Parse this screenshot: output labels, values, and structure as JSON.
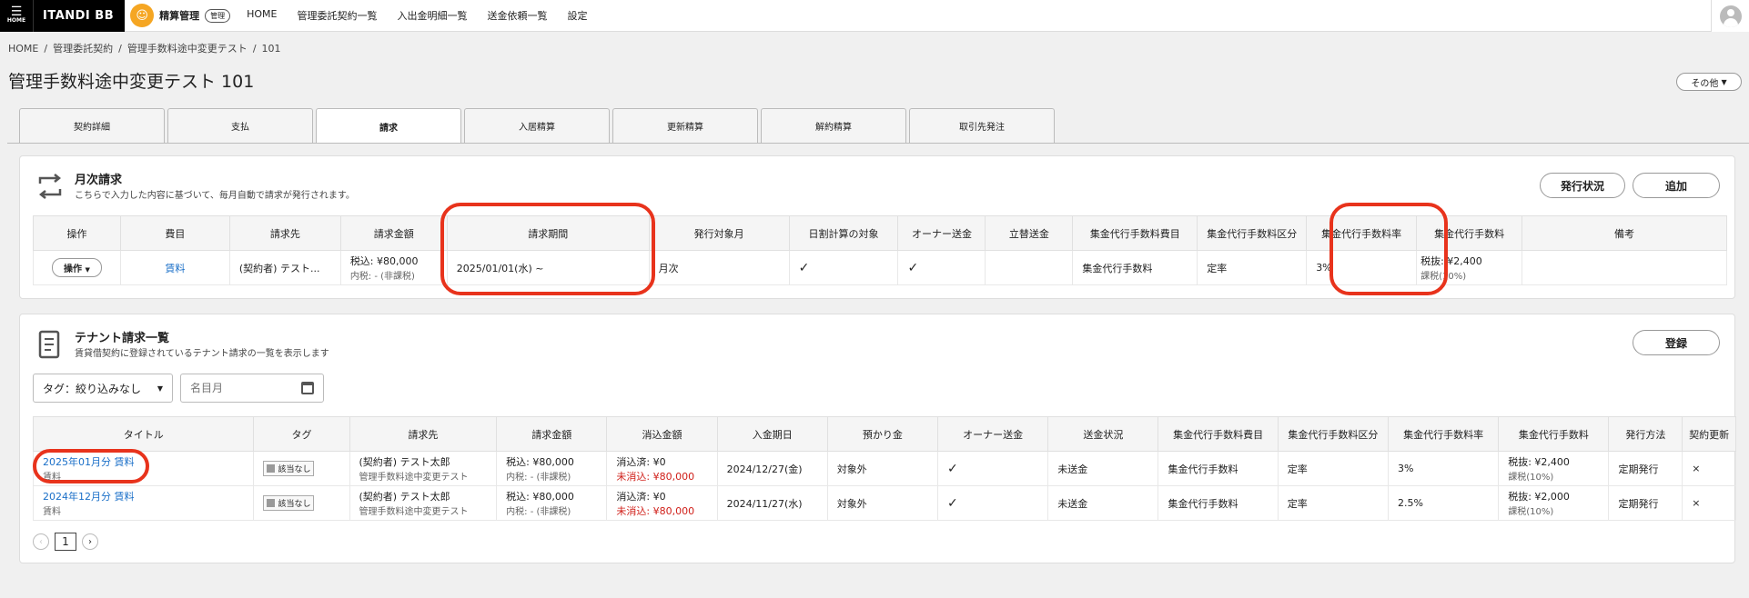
{
  "topbar": {
    "home": "HOME",
    "brand": "ITANDI BB",
    "app_name": "精算管理",
    "admin_badge": "管理",
    "nav": [
      "HOME",
      "管理委託契約一覧",
      "入出金明細一覧",
      "送金依頼一覧",
      "設定"
    ]
  },
  "breadcrumb": [
    "HOME",
    "管理委託契約",
    "管理手数料途中変更テスト",
    "101"
  ],
  "page_title": "管理手数料途中変更テスト 101",
  "other_button": "その他",
  "tabs": [
    "契約詳細",
    "支払",
    "請求",
    "入居精算",
    "更新精算",
    "解約精算",
    "取引先発注"
  ],
  "active_tab": "請求",
  "monthly": {
    "title": "月次請求",
    "subtitle": "こちらで入力した内容に基づいて、毎月自動で請求が発行されます。",
    "status_button": "発行状況",
    "add_button": "追加",
    "headers": [
      "操作",
      "費目",
      "請求先",
      "請求金額",
      "請求期間",
      "発行対象月",
      "日割計算の対象",
      "オーナー送金",
      "立替送金",
      "集金代行手数料費目",
      "集金代行手数料区分",
      "集金代行手数料率",
      "集金代行手数料",
      "備考"
    ],
    "row": {
      "ops": "操作",
      "item": "賃料",
      "bill_to": "(契約者) テスト...",
      "amount": "税込: ¥80,000",
      "amount_tax": "内税: - (非課税)",
      "period": "2025/01/01(水) ~",
      "issue_month": "月次",
      "prorate": "✓",
      "owner_remit": "✓",
      "advance": "",
      "fee_item": "集金代行手数料",
      "fee_type": "定率",
      "fee_rate": "3%",
      "fee": "税抜: ¥2,400",
      "fee_tax": "課税(10%)",
      "note": ""
    }
  },
  "tenant": {
    "title": "テナント請求一覧",
    "subtitle": "賃貸借契約に登録されているテナント請求の一覧を表示します",
    "register_button": "登録",
    "tag_filter": "タグ：絞り込みなし",
    "month_placeholder": "名目月",
    "headers": [
      "タイトル",
      "タグ",
      "請求先",
      "請求金額",
      "消込金額",
      "入金期日",
      "預かり金",
      "オーナー送金",
      "送金状況",
      "集金代行手数料費目",
      "集金代行手数料区分",
      "集金代行手数料率",
      "集金代行手数料",
      "発行方法",
      "契約更新"
    ],
    "rows": [
      {
        "title": "2025年01月分 賃料",
        "title_sub": "賃料",
        "tag": "該当なし",
        "bill_to": "(契約者) テスト太郎",
        "bill_to_sub": "管理手数料途中変更テスト",
        "amount": "税込: ¥80,000",
        "amount_tax": "内税: - (非課税)",
        "cleared": "消込済: ¥0",
        "uncleared": "未消込: ¥80,000",
        "due": "2024/12/27(金)",
        "deposit": "対象外",
        "owner_remit": "✓",
        "remit_status": "未送金",
        "fee_item": "集金代行手数料",
        "fee_type": "定率",
        "fee_rate": "3%",
        "fee": "税抜: ¥2,400",
        "fee_tax": "課税(10%)",
        "method": "定期発行",
        "renewal": "×"
      },
      {
        "title": "2024年12月分 賃料",
        "title_sub": "賃料",
        "tag": "該当なし",
        "bill_to": "(契約者) テスト太郎",
        "bill_to_sub": "管理手数料途中変更テスト",
        "amount": "税込: ¥80,000",
        "amount_tax": "内税: - (非課税)",
        "cleared": "消込済: ¥0",
        "uncleared": "未消込: ¥80,000",
        "due": "2024/11/27(水)",
        "deposit": "対象外",
        "owner_remit": "✓",
        "remit_status": "未送金",
        "fee_item": "集金代行手数料",
        "fee_type": "定率",
        "fee_rate": "2.5%",
        "fee": "税抜: ¥2,000",
        "fee_tax": "課税(10%)",
        "method": "定期発行",
        "renewal": "×"
      }
    ],
    "pager": {
      "prev": "‹",
      "page": "1",
      "next": "›"
    }
  },
  "colors": {
    "accent": "#e8331c",
    "link": "#1a6fc8"
  }
}
